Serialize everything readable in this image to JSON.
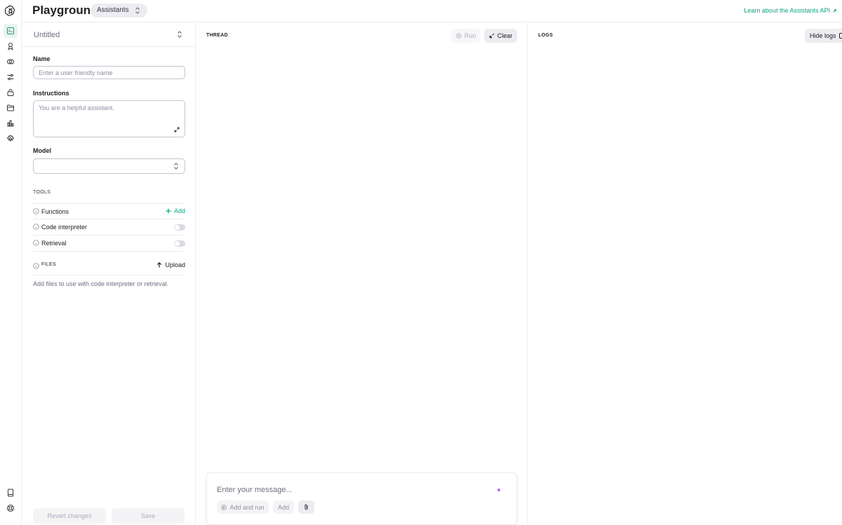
{
  "header": {
    "title": "Playground",
    "mode": "Assistants",
    "learn_link": "Learn about the Assistants API"
  },
  "rail": {
    "items": [
      {
        "icon": "terminal-icon",
        "active": true
      },
      {
        "icon": "assistant-icon"
      },
      {
        "icon": "fine-tune-icon"
      },
      {
        "icon": "sliders-icon"
      },
      {
        "icon": "lock-icon"
      },
      {
        "icon": "folder-icon"
      },
      {
        "icon": "chart-icon"
      },
      {
        "icon": "gear-icon"
      }
    ],
    "bottom": [
      "book-icon",
      "help-circle-icon"
    ]
  },
  "assistant": {
    "name": "Untitled",
    "name_label": "Name",
    "name_placeholder": "Enter a user friendly name",
    "instructions_label": "Instructions",
    "instructions_placeholder": "You are a helpful assistant.",
    "model_label": "Model",
    "model_value": ""
  },
  "tools": {
    "title": "TOOLS",
    "functions_label": "Functions",
    "add_label": "Add",
    "code_interpreter_label": "Code interpreter",
    "code_interpreter_enabled": false,
    "retrieval_label": "Retrieval",
    "retrieval_enabled": false
  },
  "files": {
    "title": "FILES",
    "upload_label": "Upload",
    "hint": "Add files to use with code interpreter or retrieval."
  },
  "footer": {
    "revert_label": "Revert changes",
    "save_label": "Save"
  },
  "thread": {
    "title": "THREAD",
    "run_label": "Run",
    "clear_label": "Clear",
    "message_placeholder": "Enter your message...",
    "add_and_run_label": "Add and run",
    "add_label": "Add"
  },
  "logs": {
    "title": "LOGS",
    "hide_label": "Hide logs"
  },
  "colors": {
    "accent": "#10a37f",
    "border": "#ececf1",
    "muted_text": "#8e8ea0"
  }
}
